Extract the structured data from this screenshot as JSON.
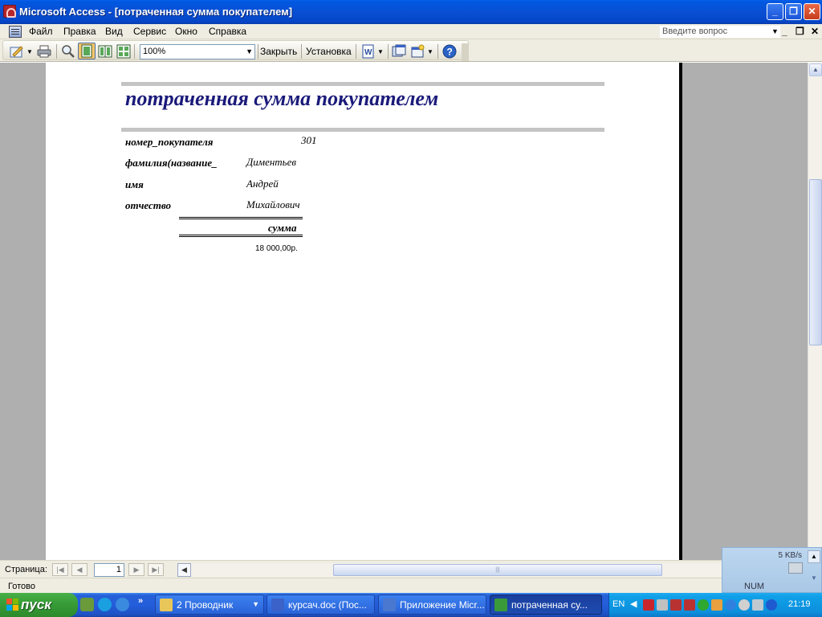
{
  "window": {
    "title": "Microsoft Access - [потраченная сумма покупателем]",
    "minimize": "_",
    "restore": "❐",
    "close": "✕"
  },
  "menu": {
    "items": [
      "Файл",
      "Правка",
      "Вид",
      "Сервис",
      "Окно",
      "Справка"
    ],
    "ask_placeholder": "Введите вопрос"
  },
  "toolbar": {
    "zoom": "100%",
    "close_label": "Закрыть",
    "setup_label": "Установка"
  },
  "report": {
    "title": "потраченная сумма покупателем",
    "fields": [
      {
        "label": "номер_покупателя",
        "value": "301"
      },
      {
        "label": "фамилия(название_",
        "value": "Диментьев"
      },
      {
        "label": "имя",
        "value": "Андрей"
      },
      {
        "label": "отчество",
        "value": "Михайлович"
      }
    ],
    "sum_header": "сумма",
    "sum_value": "18 000,00р."
  },
  "navigation": {
    "label": "Страница:",
    "page": "1"
  },
  "status": {
    "text": "Готово"
  },
  "network": {
    "speed": "5 KB/s",
    "num": "NUM"
  },
  "taskbar": {
    "start": "пуск",
    "tasks": [
      {
        "label": "2 Проводник",
        "icon_color": "#e8c65a"
      },
      {
        "label": "курсач.doc (Пос...",
        "icon_color": "#3a62c8"
      },
      {
        "label": "Приложение Micr...",
        "icon_color": "#4a78d0"
      },
      {
        "label": "потраченная су...",
        "icon_color": "#3a9a3a"
      }
    ],
    "lang": "EN",
    "clock": "21:19"
  }
}
